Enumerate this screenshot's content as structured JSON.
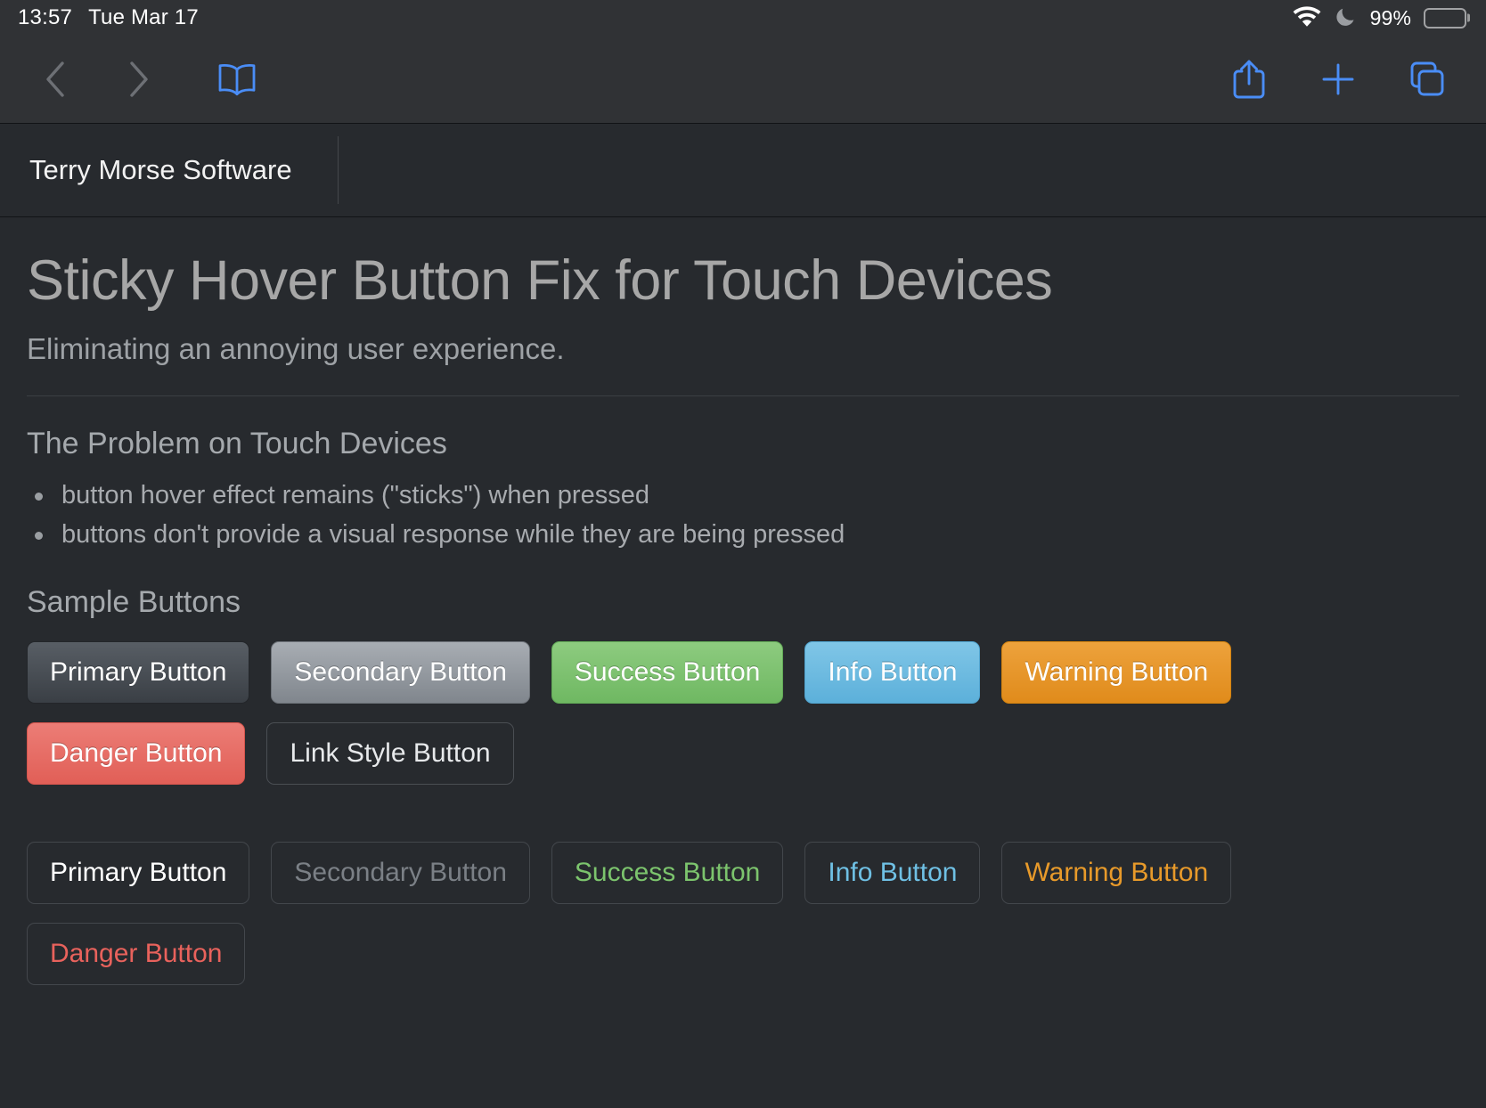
{
  "statusbar": {
    "time": "13:57",
    "date": "Tue Mar 17",
    "wifi_icon": "wifi-icon",
    "dnd_icon": "crescent-moon-icon",
    "battery_percent": "99%",
    "battery_icon": "battery-icon"
  },
  "toolbar": {
    "back_icon": "chevron-left-icon",
    "forward_icon": "chevron-right-icon",
    "reader_icon": "book-icon",
    "share_icon": "share-icon",
    "new_tab_icon": "plus-icon",
    "tabs_icon": "tabs-overview-icon",
    "accent_color": "#4a8df6",
    "disabled_color": "#6d7075"
  },
  "tabs": [
    {
      "title": "Terry Morse Software"
    }
  ],
  "article": {
    "title": "Sticky Hover Button Fix for Touch Devices",
    "subtitle": "Eliminating an annoying user experience.",
    "problem_heading": "The Problem on Touch Devices",
    "problem_bullets": [
      "button hover effect remains (\"sticks\") when pressed",
      "buttons don't provide a visual response while they are being pressed"
    ],
    "samples_heading": "Sample Buttons",
    "solid_buttons": [
      {
        "label": "Primary Button",
        "variant": "primary",
        "color": "#454b52"
      },
      {
        "label": "Secondary Button",
        "variant": "secondary",
        "color": "#93989e"
      },
      {
        "label": "Success Button",
        "variant": "success",
        "color": "#7dc26f"
      },
      {
        "label": "Info Button",
        "variant": "info",
        "color": "#6dbbe1"
      },
      {
        "label": "Warning Button",
        "variant": "warning",
        "color": "#e6952b"
      },
      {
        "label": "Danger Button",
        "variant": "danger",
        "color": "#e66f67"
      }
    ],
    "link_button": {
      "label": "Link Style Button",
      "variant": "link"
    },
    "outline_buttons": [
      {
        "label": "Primary Button",
        "variant": "primary",
        "color": "#ffffff"
      },
      {
        "label": "Secondary Button",
        "variant": "secondary",
        "color": "#7b8086"
      },
      {
        "label": "Success Button",
        "variant": "success",
        "color": "#7cc46d"
      },
      {
        "label": "Info Button",
        "variant": "info",
        "color": "#6fc0e4"
      },
      {
        "label": "Warning Button",
        "variant": "warning",
        "color": "#e89a2a"
      },
      {
        "label": "Danger Button",
        "variant": "danger",
        "color": "#e8625c"
      }
    ]
  }
}
